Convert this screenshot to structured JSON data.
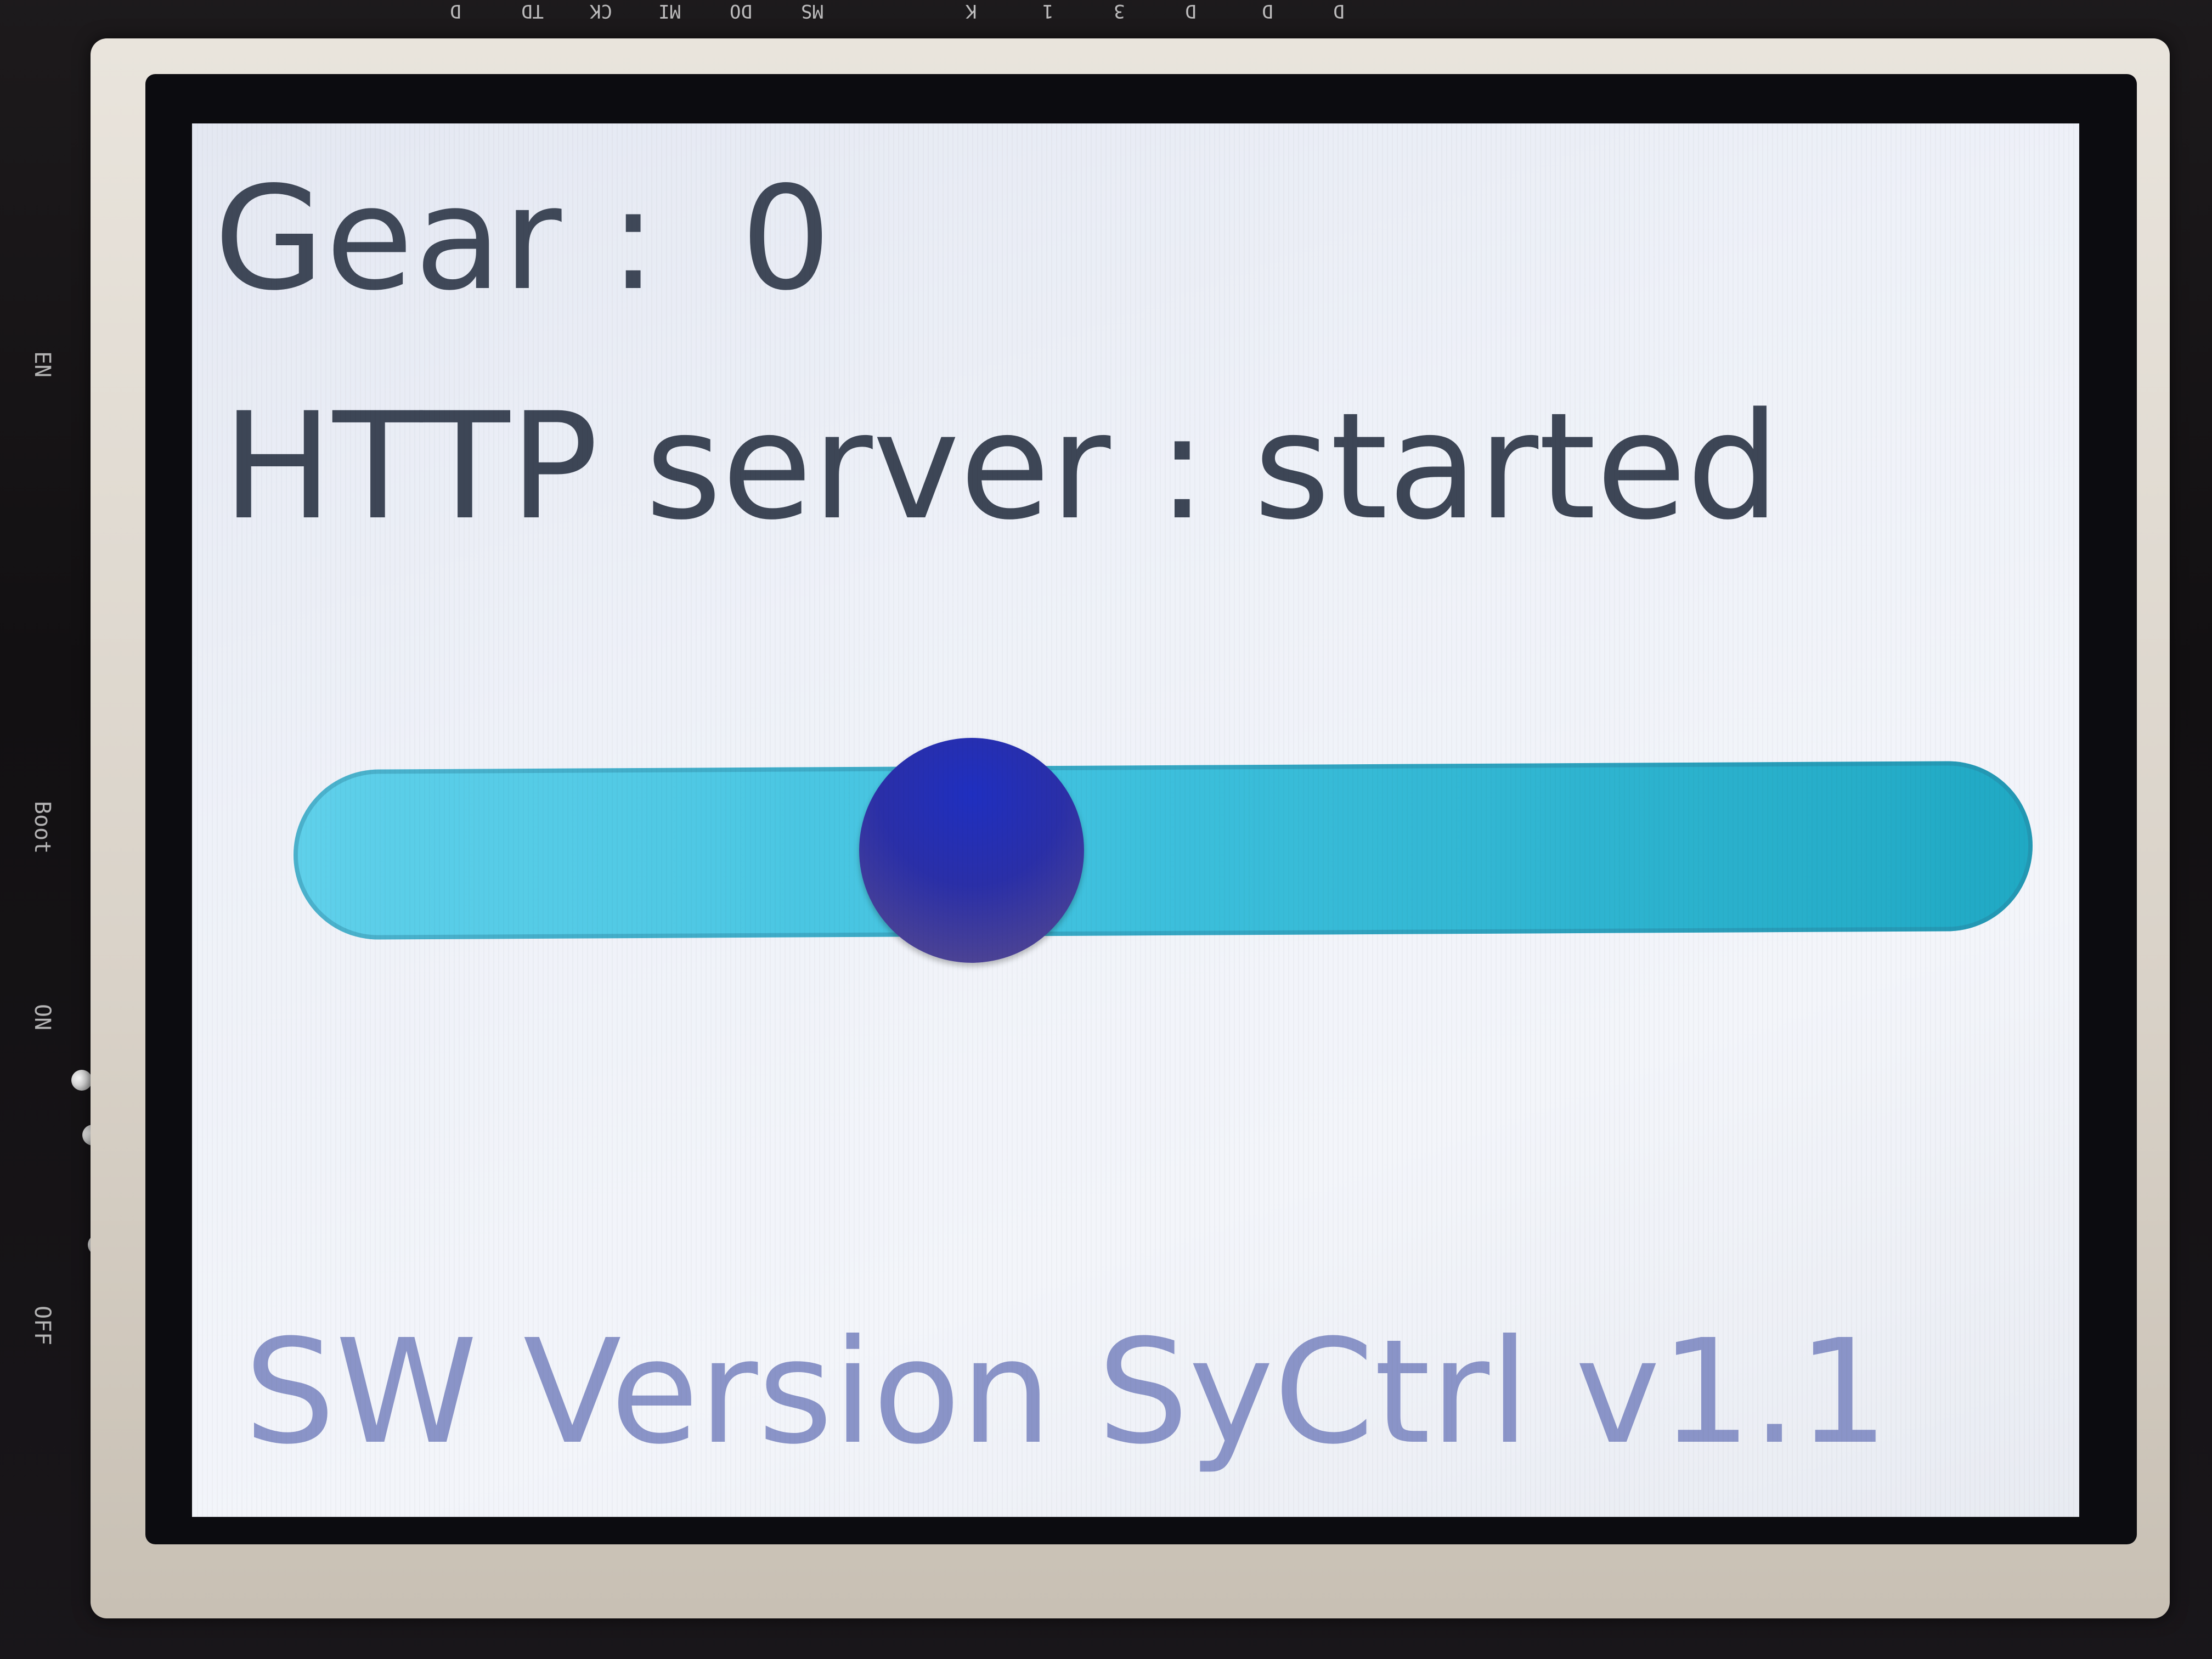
{
  "board": {
    "top_pins": [
      "D",
      "TD",
      "CK",
      "MI",
      "DO",
      "MS",
      "K",
      "1",
      "3",
      "D",
      "D",
      "D"
    ],
    "side_labels": [
      "EN",
      "Boot",
      "ON",
      "OFF"
    ]
  },
  "display": {
    "gear_label": "Gear :",
    "gear_value": "0",
    "http_status": "HTTP server : started",
    "slider_fraction": 0.39,
    "version_text": "SW Version SyCtrl v1.1",
    "colors": {
      "screen_bg": "#eef1f8",
      "text_primary": "#3f4858",
      "version_text": "#8a94c8",
      "slider_track": "#3fc1de",
      "slider_knob": "#2a2fa8"
    }
  }
}
